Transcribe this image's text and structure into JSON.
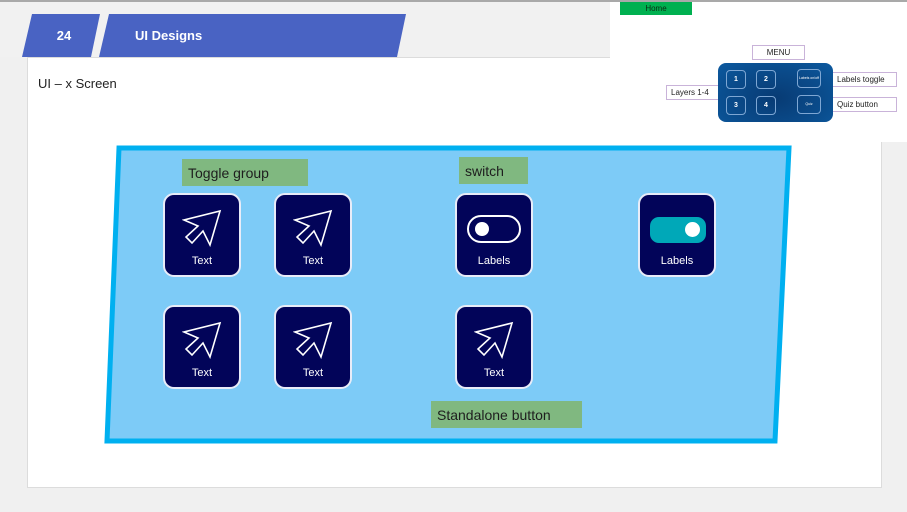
{
  "slide": {
    "number": "24",
    "title": "UI Designs",
    "subtitle": "UI – x Screen"
  },
  "nav": {
    "home_label": "Home"
  },
  "menu_legend": {
    "title": "MENU",
    "layer_buttons": [
      "1",
      "2",
      "3",
      "4"
    ],
    "labels_button": "Labels on/off",
    "quiz_button": "Quiz",
    "callouts": {
      "layers": "Layers 1-4",
      "labels_toggle": "Labels toggle",
      "quiz": "Quiz button"
    }
  },
  "colors": {
    "tab_blue": "#4963c3",
    "home_green": "#00b050",
    "panel_fill": "#7dcbf7",
    "panel_border": "#00b0f0",
    "card_navy": "#020459",
    "switch_on": "#00a8b8",
    "note_green": "#80b880"
  },
  "canvas": {
    "notes": {
      "toggle_group": "Toggle group",
      "switch": "switch",
      "standalone": "Standalone button"
    },
    "toggle_group": [
      {
        "label": "Text",
        "icon": "cursor-arrow-icon"
      },
      {
        "label": "Text",
        "icon": "cursor-arrow-icon"
      },
      {
        "label": "Text",
        "icon": "cursor-arrow-icon"
      },
      {
        "label": "Text",
        "icon": "cursor-arrow-icon"
      }
    ],
    "switches": [
      {
        "label": "Labels",
        "state": "off"
      },
      {
        "label": "Labels",
        "state": "on"
      }
    ],
    "standalone": {
      "label": "Text",
      "icon": "cursor-arrow-icon"
    }
  }
}
